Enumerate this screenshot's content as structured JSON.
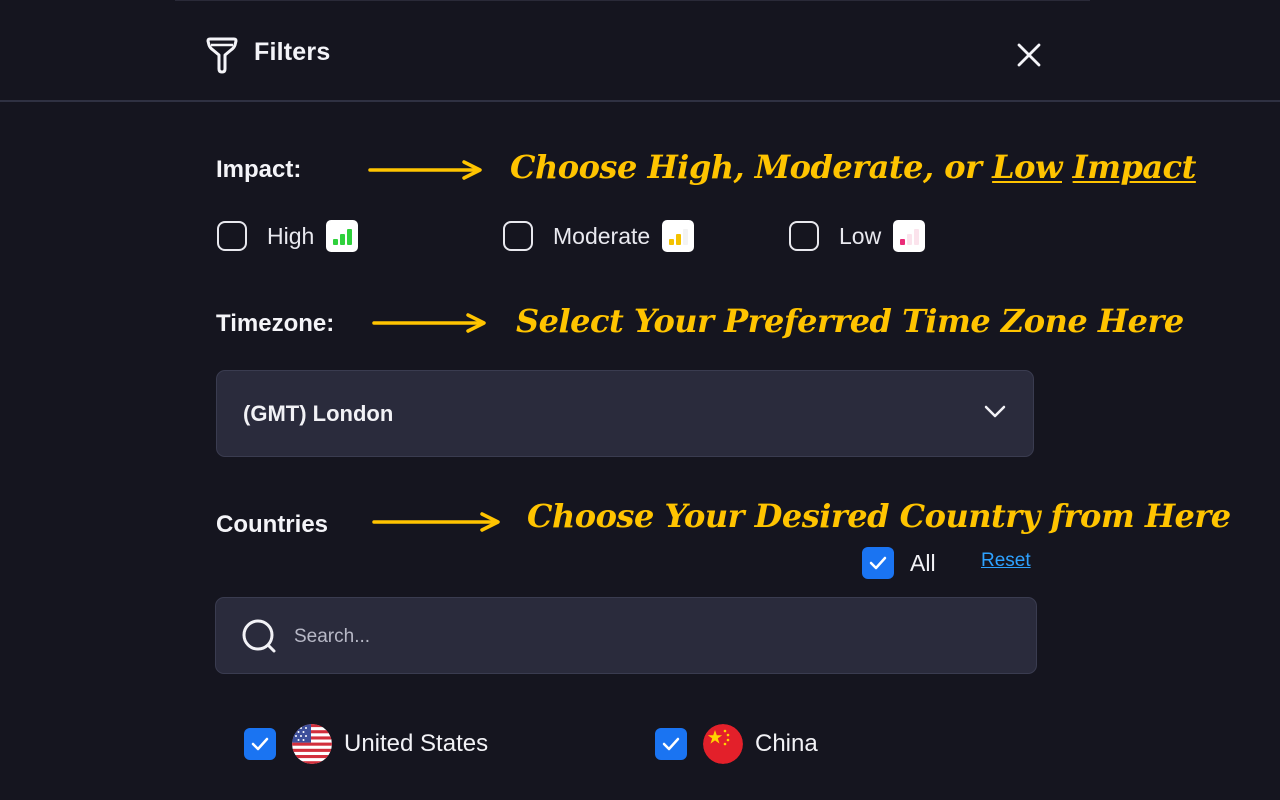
{
  "header": {
    "title": "Filters"
  },
  "impact": {
    "label": "Impact:",
    "annotation_parts": [
      "Choose High, Moderate, or ",
      "Low",
      " ",
      "Impact"
    ],
    "options": [
      {
        "label": "High",
        "checked": false,
        "bar_color": "#2fd13c"
      },
      {
        "label": "Moderate",
        "checked": false,
        "bar_color": "#f3c200"
      },
      {
        "label": "Low",
        "checked": false,
        "bar_color": "#ea2b78"
      }
    ]
  },
  "timezone": {
    "label": "Timezone:",
    "annotation": "Select Your Preferred Time Zone Here",
    "selected": "(GMT) London"
  },
  "countries": {
    "label": "Countries",
    "annotation": "Choose Your Desired Country from Here",
    "all_label": "All",
    "all_checked": true,
    "reset_label": "Reset",
    "search_placeholder": "Search...",
    "items": [
      {
        "name": "United States",
        "checked": true,
        "flag_icon": "us-flag-icon"
      },
      {
        "name": "China",
        "checked": true,
        "flag_icon": "china-flag-icon"
      }
    ]
  },
  "colors": {
    "background": "#15151f",
    "panel": "#2a2b3c",
    "accent": "#1a74f2",
    "annotation": "#ffc400",
    "link": "#2ea2ff"
  }
}
